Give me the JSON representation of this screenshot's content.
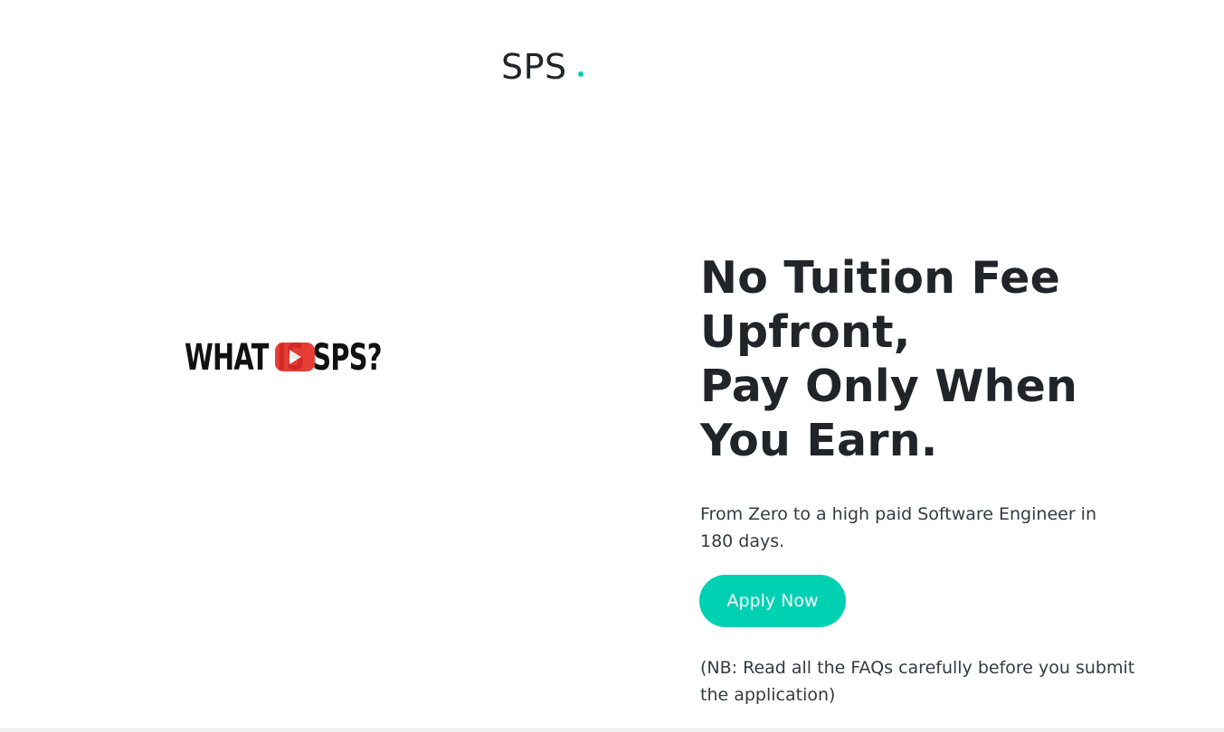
{
  "header": {
    "brand": "SPS",
    "brand_accent_color": "#00d1b2"
  },
  "video": {
    "thumbnail_text": "WHAT IS SPS?",
    "play_icon": "youtube-play-icon"
  },
  "hero": {
    "title_lines": [
      "No Tuition Fee",
      "Upfront,",
      "Pay Only When",
      "You Earn."
    ],
    "subtitle": "From Zero to a high paid Software Engineer in 180 days.",
    "apply_label": "Apply Now",
    "apply_color": "#00d1b2",
    "note": "(NB: Read all the FAQs carefully before you submit the application)"
  }
}
